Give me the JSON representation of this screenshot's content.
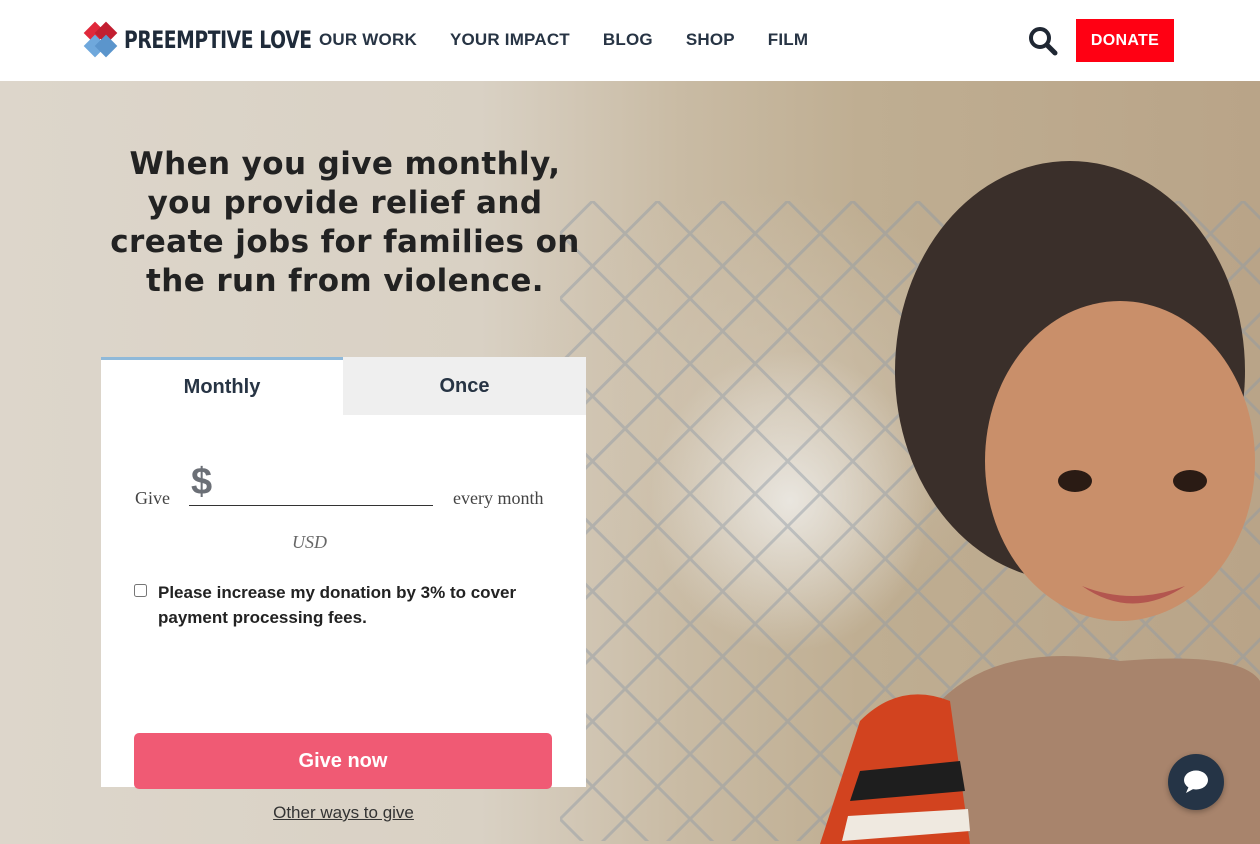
{
  "brand": {
    "name": "PREEMPTIVE LOVE"
  },
  "nav": {
    "items": [
      "OUR WORK",
      "YOUR IMPACT",
      "BLOG",
      "SHOP",
      "FILM"
    ]
  },
  "header": {
    "donate_label": "DONATE",
    "search_icon": "search-icon"
  },
  "hero": {
    "headline": "When you give monthly, you provide relief and create jobs for families on the run from violence."
  },
  "donation_form": {
    "tabs": [
      {
        "label": "Monthly",
        "active": true
      },
      {
        "label": "Once",
        "active": false
      }
    ],
    "give_label": "Give",
    "currency_symbol": "$",
    "amount_value": "",
    "frequency_label": "every month",
    "currency_code": "USD",
    "fee_checkbox_checked": false,
    "fee_text": "Please increase my donation by 3% to cover payment processing fees.",
    "submit_label": "Give now",
    "other_ways_label": "Other ways to give"
  },
  "chat": {
    "icon": "chat-bubble-icon"
  },
  "colors": {
    "donate_red": "#ff0013",
    "give_now_pink": "#f05a74",
    "nav_text": "#273444",
    "active_tab_border": "#8fb9d9"
  }
}
